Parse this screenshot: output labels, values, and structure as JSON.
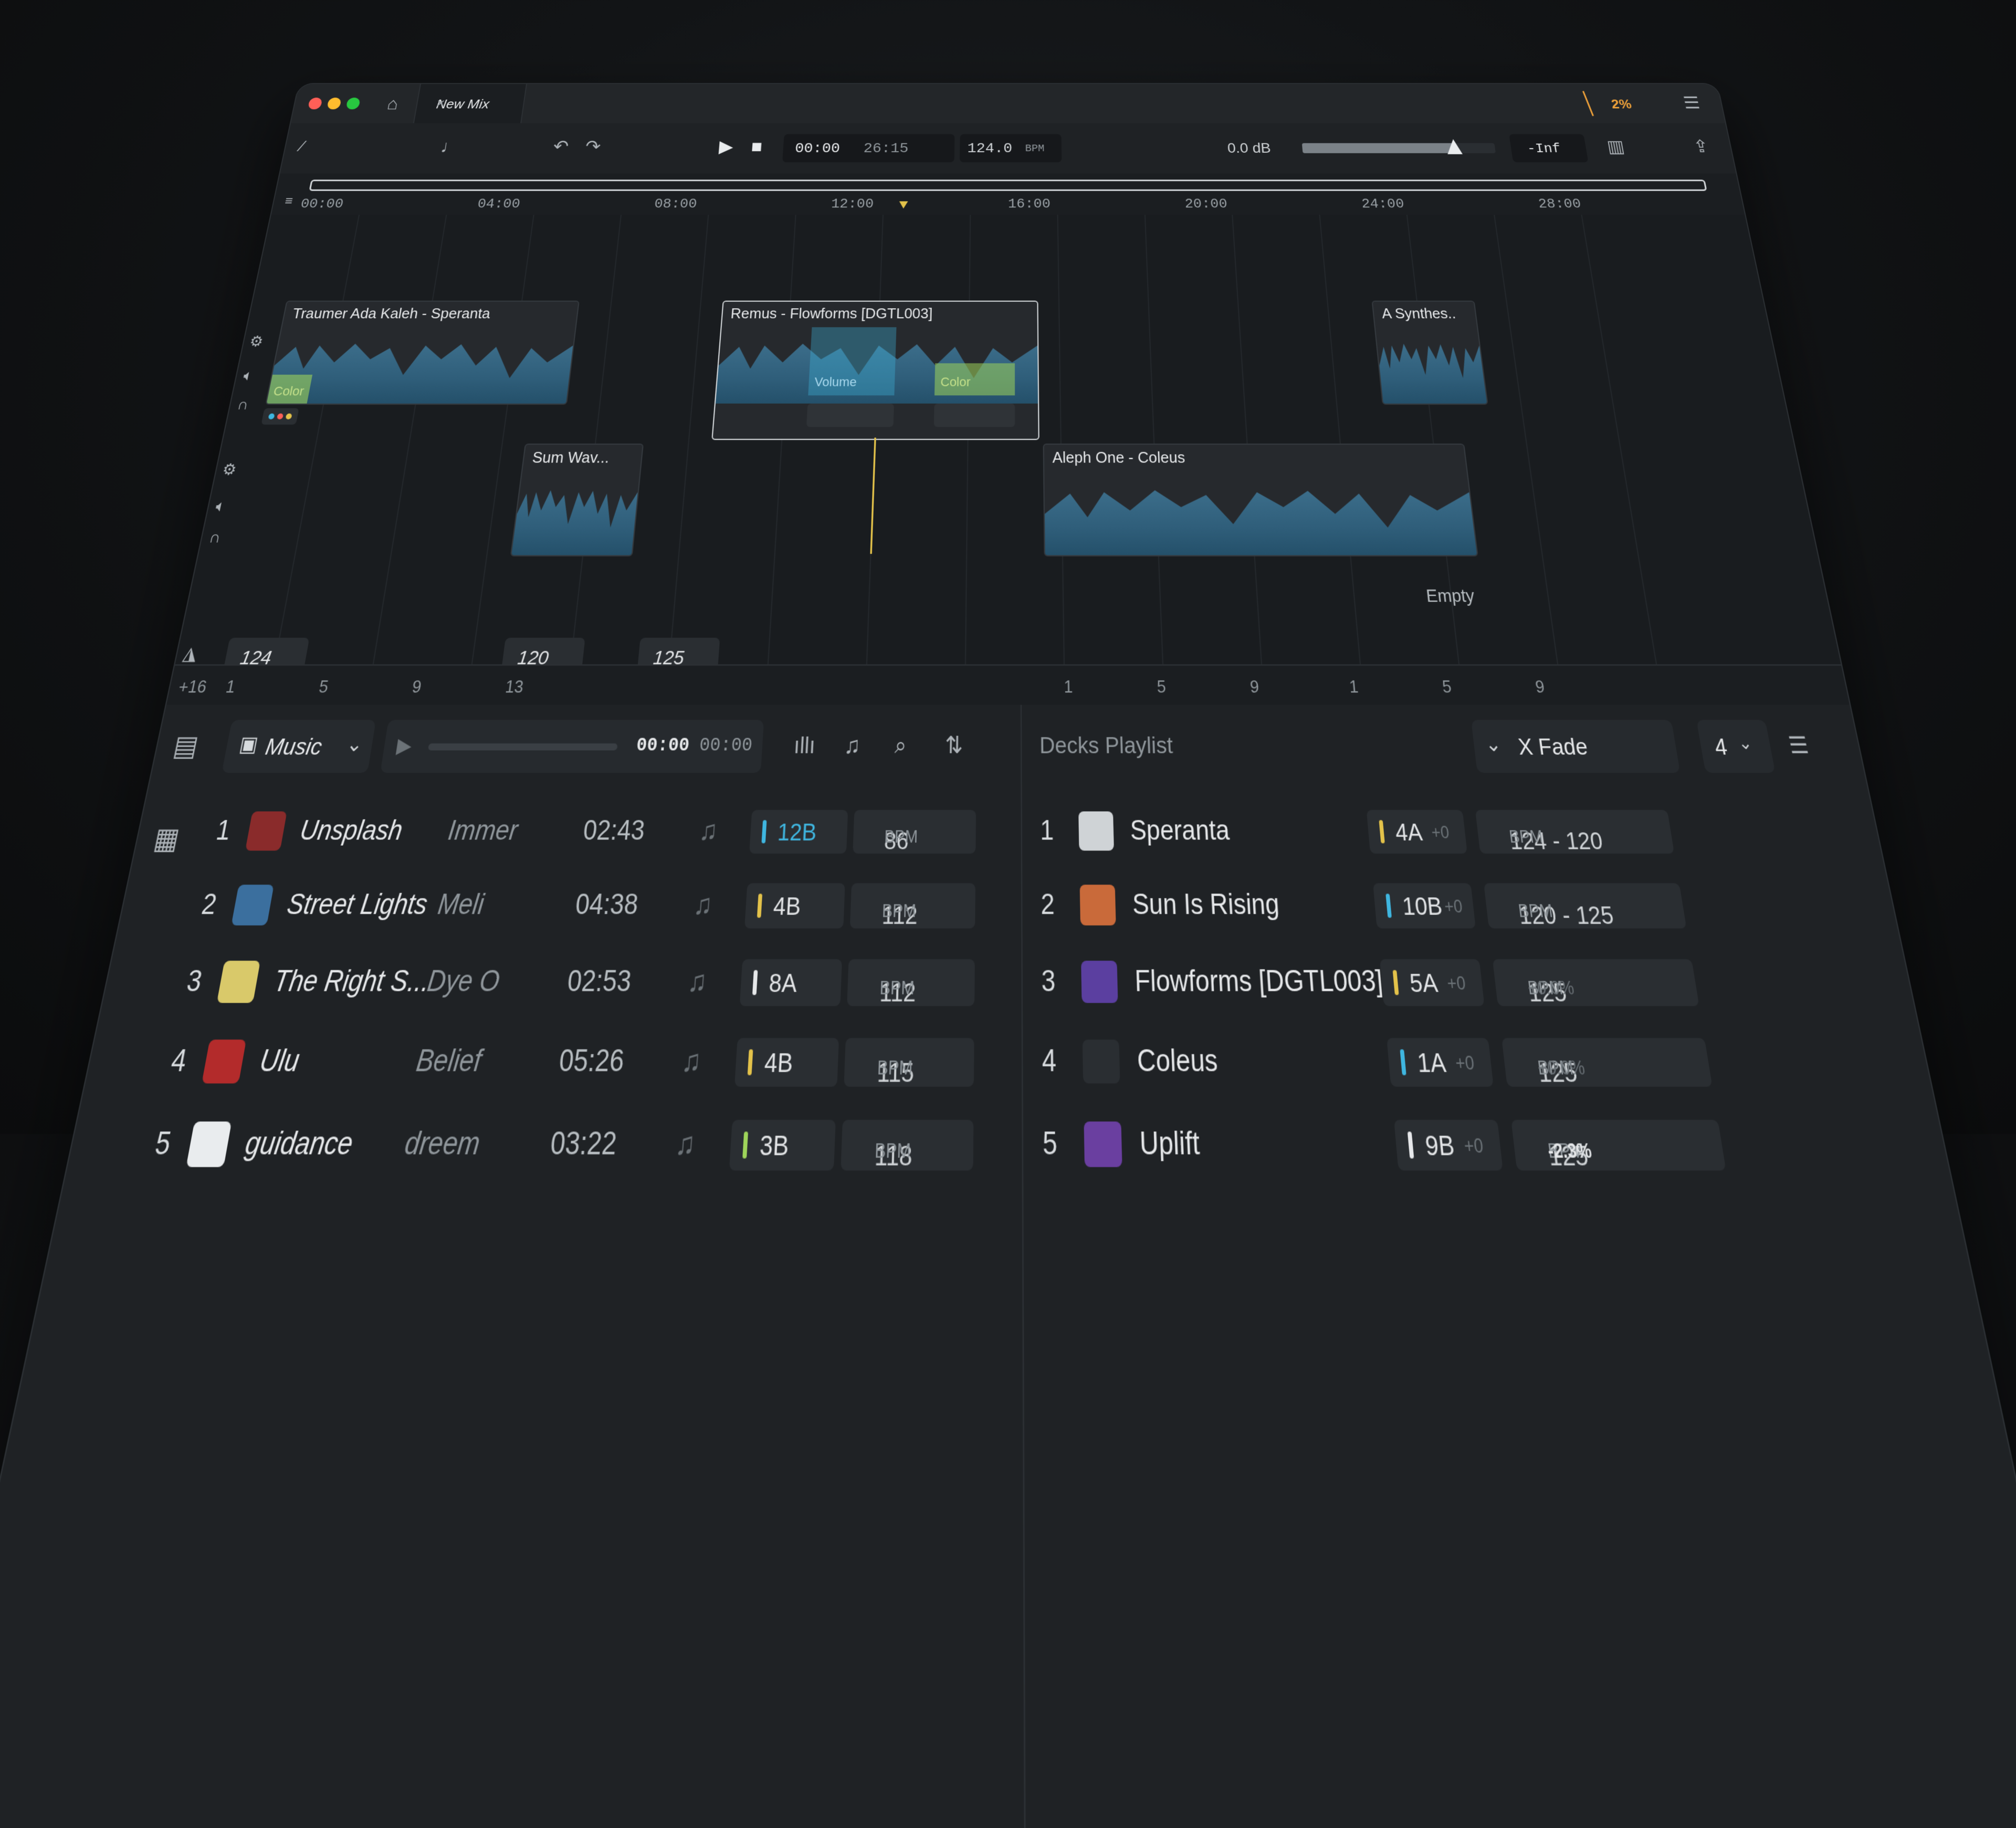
{
  "window": {
    "tab_title": "New Mix",
    "tab_close": "×",
    "cpu_load": "2%",
    "menu_icon": "menu-icon"
  },
  "transport": {
    "time_position": "00:00",
    "time_total": "26:15",
    "bpm_value": "124.0",
    "bpm_unit": "BPM",
    "gain": "0.0 dB",
    "level": "-Inf",
    "volume_level": 0.8
  },
  "ruler": {
    "marks": [
      "00:00",
      "04:00",
      "08:00",
      "12:00",
      "16:00",
      "20:00",
      "24:00",
      "28:00"
    ]
  },
  "clips": {
    "traumer": "Traumer Ada Kaleh - Speranta",
    "traumer_color_label": "Color",
    "remus": "Remus - Flowforms [DGTL003]",
    "remus_volume_label": "Volume",
    "remus_color_label": "Color",
    "synthes": "A Synthes..",
    "sumwav": "Sum Wav...",
    "aleph": "Aleph One - Coleus",
    "empty_label": "Empty"
  },
  "tempo_markers": [
    "124",
    "120",
    "125"
  ],
  "bars_ruler": {
    "zoom": "+16",
    "marks": [
      "1",
      "5",
      "9",
      "13",
      "1",
      "5",
      "9",
      "1",
      "5",
      "9"
    ]
  },
  "library": {
    "source": "Music",
    "player_time": "00:00",
    "player_total": "00:00",
    "tracks": [
      {
        "n": "1",
        "title": "Unsplash",
        "artist": "Immer",
        "dur": "02:43",
        "key": "12B",
        "key_color": "#3fb6e0",
        "bpm": "86",
        "bpm_unit": "BPM",
        "thumb": "#8a2b2b"
      },
      {
        "n": "2",
        "title": "Street Lights",
        "artist": "Meli",
        "dur": "04:38",
        "key": "4B",
        "key_color": "#e3c24a",
        "bpm": "112",
        "bpm_unit": "BPM",
        "thumb": "#3b6f9e"
      },
      {
        "n": "3",
        "title": "The Right S...",
        "artist": "Dye O",
        "dur": "02:53",
        "key": "8A",
        "key_color": "#e6e8ea",
        "bpm": "112",
        "bpm_unit": "BPM",
        "thumb": "#d9c96a"
      },
      {
        "n": "4",
        "title": "Ulu",
        "artist": "Belief",
        "dur": "05:26",
        "key": "4B",
        "key_color": "#e3c24a",
        "bpm": "115",
        "bpm_unit": "BPM",
        "thumb": "#b32b2b"
      },
      {
        "n": "5",
        "title": "guidance",
        "artist": "dreem",
        "dur": "03:22",
        "key": "3B",
        "key_color": "#9ed45a",
        "bpm": "118",
        "bpm_unit": "BPM",
        "thumb": "#e9ecee"
      }
    ]
  },
  "playlist": {
    "title": "Decks Playlist",
    "transition": "X Fade",
    "deck_count": "4",
    "items": [
      {
        "n": "1",
        "title": "Speranta",
        "key": "4A",
        "key_color": "#e3c24a",
        "shift": "+0",
        "bpm": "124 - 120",
        "bpm_unit": "BPM",
        "pct": "",
        "thumb": "#cfd3d6"
      },
      {
        "n": "2",
        "title": "Sun Is Rising",
        "key": "10B",
        "key_color": "#3fb6e0",
        "shift": "+0",
        "bpm": "120 - 125",
        "bpm_unit": "BPM",
        "pct": "",
        "thumb": "#c96a3a"
      },
      {
        "n": "3",
        "title": "Flowforms [DGTL003]",
        "key": "5A",
        "key_color": "#e3c24a",
        "shift": "+0",
        "bpm": "125",
        "bpm_unit": "BPM",
        "pct": "+0.0%",
        "thumb": "#5b3fa0"
      },
      {
        "n": "4",
        "title": "Coleus",
        "key": "1A",
        "key_color": "#3fb6e0",
        "shift": "+0",
        "bpm": "125",
        "bpm_unit": "BPM",
        "pct": "+0.0%",
        "thumb": "#2a2e32"
      },
      {
        "n": "5",
        "title": "Uplift",
        "key": "9B",
        "key_color": "#e6e8ea",
        "shift": "+0",
        "bpm": "125",
        "bpm_unit": "BPM",
        "pct": "-2.3%",
        "thumb": "#6a3fa0"
      }
    ]
  },
  "colors": {
    "accent_yellow": "#e3c24a",
    "accent_blue": "#3fb6e0",
    "cpu_orange": "#f0a23a"
  }
}
